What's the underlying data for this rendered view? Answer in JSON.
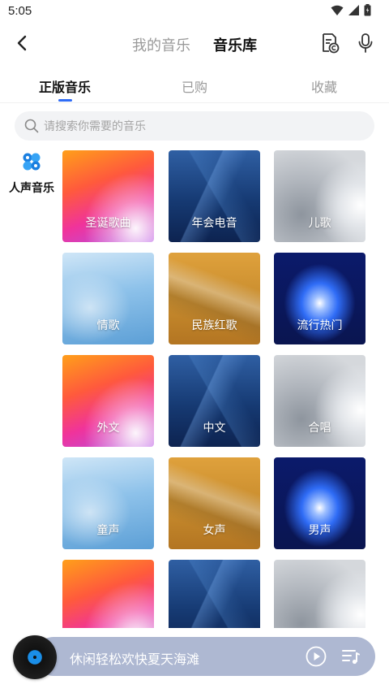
{
  "status_bar": {
    "time": "5:05"
  },
  "header": {
    "tabs": [
      {
        "label": "我的音乐",
        "active": false
      },
      {
        "label": "音乐库",
        "active": true
      }
    ]
  },
  "sub_tabs": [
    {
      "label": "正版音乐",
      "active": true
    },
    {
      "label": "已购",
      "active": false
    },
    {
      "label": "收藏",
      "active": false
    }
  ],
  "search": {
    "placeholder": "请搜索你需要的音乐"
  },
  "sidebar": {
    "category_label": "人声音乐"
  },
  "categories": [
    {
      "label": "圣诞歌曲",
      "style": "warm"
    },
    {
      "label": "年会电音",
      "style": "blue"
    },
    {
      "label": "儿歌",
      "style": "grey"
    },
    {
      "label": "情歌",
      "style": "sky"
    },
    {
      "label": "民族红歌",
      "style": "gold"
    },
    {
      "label": "流行热门",
      "style": "navy"
    },
    {
      "label": "外文",
      "style": "warm"
    },
    {
      "label": "中文",
      "style": "blue"
    },
    {
      "label": "合唱",
      "style": "grey"
    },
    {
      "label": "童声",
      "style": "sky"
    },
    {
      "label": "女声",
      "style": "gold"
    },
    {
      "label": "男声",
      "style": "navy"
    },
    {
      "label": "",
      "style": "warm"
    },
    {
      "label": "",
      "style": "blue"
    },
    {
      "label": "",
      "style": "grey"
    }
  ],
  "player": {
    "title": "休闲轻松欢快夏天海滩"
  },
  "colors": {
    "accent": "#2f6cf6",
    "player_bar": "#aeb8d2"
  }
}
